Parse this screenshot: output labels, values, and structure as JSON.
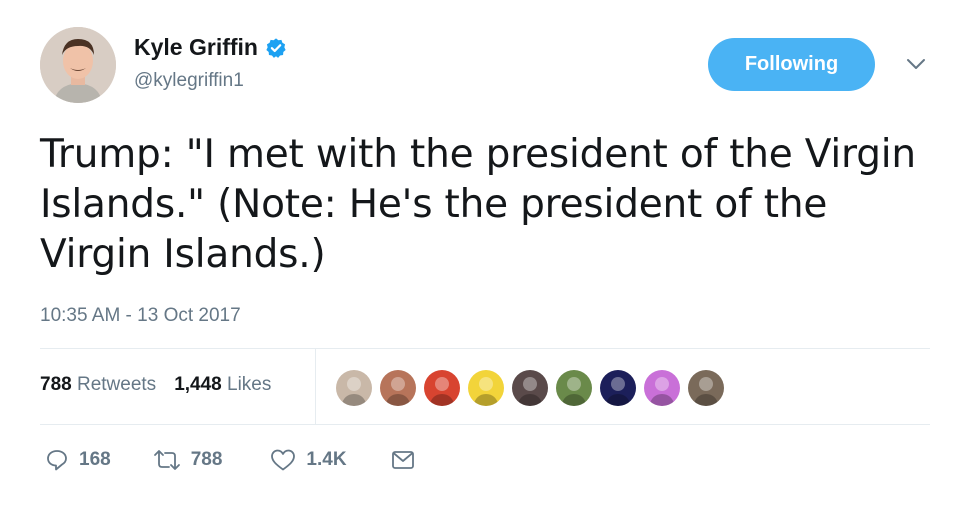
{
  "user": {
    "name": "Kyle Griffin",
    "handle": "@kylegriffin1",
    "verified_icon": "verified-badge-icon",
    "accent_color": "#1da1f2"
  },
  "follow_button": {
    "label": "Following",
    "color": "#4ab3f4"
  },
  "tweet": {
    "text": "Trump: \"I met with the president of the Virgin Islands.\" (Note: He's the president of the Virgin Islands.)",
    "timestamp": "10:35 AM - 13 Oct 2017"
  },
  "stats": {
    "retweets_count": "788",
    "retweets_label": "Retweets",
    "likes_count": "1,448",
    "likes_label": "Likes"
  },
  "actions": {
    "reply_count": "168",
    "retweet_count": "788",
    "like_count": "1.4K"
  },
  "likers": [
    {
      "color": "#c9b8a8"
    },
    {
      "color": "#b7745a"
    },
    {
      "color": "#d84430"
    },
    {
      "color": "#f2d43a"
    },
    {
      "color": "#5a4a4a"
    },
    {
      "color": "#6a8a4a"
    },
    {
      "color": "#1c1f5a"
    },
    {
      "color": "#c970d8"
    },
    {
      "color": "#7a6a5a"
    }
  ]
}
